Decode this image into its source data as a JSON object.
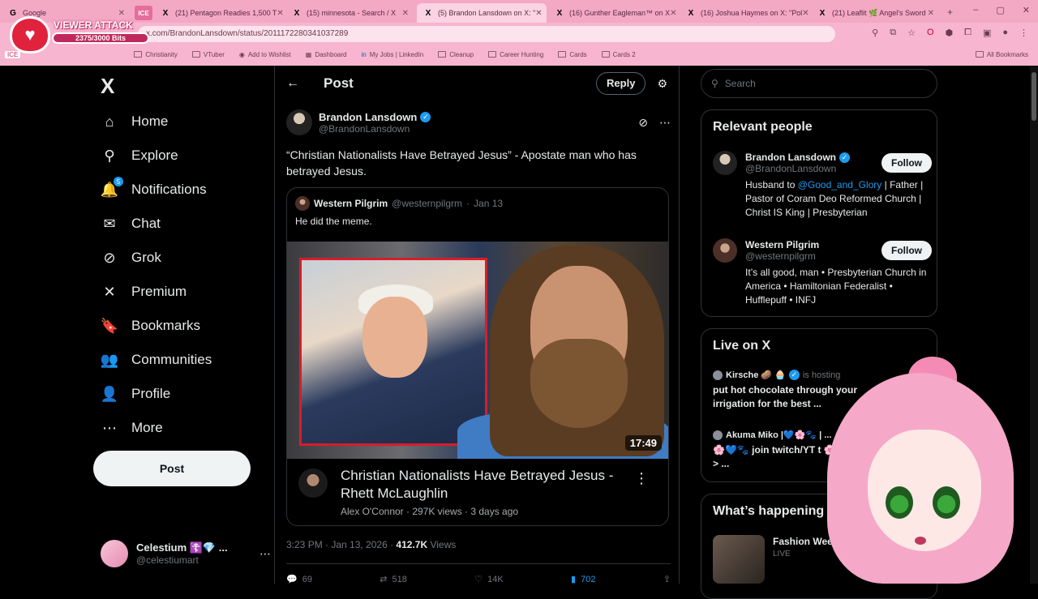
{
  "browser": {
    "tabs": [
      {
        "icon": "G",
        "label": "Google",
        "active": false
      },
      {
        "icon": "X",
        "label": "(21) Pentagon Readies 1,500 T",
        "active": false
      },
      {
        "icon": "X",
        "label": "(15) minnesota - Search / X",
        "active": false
      },
      {
        "icon": "X",
        "label": "(5) Brandon Lansdown on X: \"",
        "active": true
      },
      {
        "icon": "X",
        "label": "(16) Gunther Eagleman™ on X",
        "active": false
      },
      {
        "icon": "X",
        "label": "(16) Joshua Haymes on X: \"Pol",
        "active": false
      },
      {
        "icon": "X",
        "label": "(21) Leaflit 🌿 Angel's Sword",
        "active": false
      }
    ],
    "ice_tab": "ICE",
    "url": "x.com/BrandonLansdown/status/2011172280341037289",
    "bookmarks": [
      "Christianity",
      "VTuber",
      "Add to Wishlist",
      "Dashboard",
      "My Jobs | LinkedIn",
      "Cleanup",
      "Career Hunting",
      "Cards",
      "Cards 2"
    ],
    "bookmarks_all": "All Bookmarks",
    "ice_label": "ICE"
  },
  "overlay": {
    "title": "VIEWER ATTACK",
    "progress": "2375/3000 Bits",
    "progress_fraction": 0.79
  },
  "nav": {
    "logo": "X",
    "items": [
      {
        "label": "Home",
        "icon": "home-icon",
        "glyph": "⌂"
      },
      {
        "label": "Explore",
        "icon": "search-icon",
        "glyph": "⚲"
      },
      {
        "label": "Notifications",
        "icon": "bell-icon",
        "glyph": "🔔",
        "badge": "5"
      },
      {
        "label": "Chat",
        "icon": "mail-icon",
        "glyph": "✉"
      },
      {
        "label": "Grok",
        "icon": "grok-icon",
        "glyph": "⊘"
      },
      {
        "label": "Premium",
        "icon": "x-icon",
        "glyph": "✕"
      },
      {
        "label": "Bookmarks",
        "icon": "bookmark-icon",
        "glyph": "🔖"
      },
      {
        "label": "Communities",
        "icon": "people-icon",
        "glyph": "👥"
      },
      {
        "label": "Profile",
        "icon": "person-icon",
        "glyph": "👤"
      },
      {
        "label": "More",
        "icon": "more-icon",
        "glyph": "⋯"
      }
    ],
    "post_button": "Post",
    "account": {
      "name": "Celestium ☦️💎 ...",
      "handle": "@celestiumart"
    }
  },
  "post": {
    "header_title": "Post",
    "reply_button": "Reply",
    "author_name": "Brandon Lansdown",
    "author_handle": "@BrandonLansdown",
    "text": "“Christian Nationalists Have Betrayed Jesus” - Apostate man who has betrayed Jesus.",
    "quote": {
      "name": "Western Pilgrim",
      "handle": "@westernpilgrm",
      "date": "Jan 13",
      "text": "He did the meme.",
      "duration": "17:49",
      "video_title": "Christian Nationalists Have Betrayed Jesus - Rhett McLaughlin",
      "video_meta": "Alex O'Connor · 297K views · 3 days ago"
    },
    "timestamp": "3:23 PM · Jan 13, 2026 · ",
    "views": "412.7K",
    "views_label": " Views",
    "actions": {
      "replies": "69",
      "reposts": "518",
      "likes": "14K",
      "bookmarks": "702"
    }
  },
  "sidebar": {
    "search_placeholder": "Search",
    "relevant_title": "Relevant people",
    "people": [
      {
        "name": "Brandon Lansdown",
        "handle": "@BrandonLansdown",
        "follow": "Follow",
        "bio_pre": "Husband to ",
        "bio_link": "@Good_and_Glory",
        "bio_post": " | Father | Pastor of Coram Deo Reformed Church | Christ IS King | Presbyterian"
      },
      {
        "name": "Western Pilgrim",
        "handle": "@westernpilgrm",
        "follow": "Follow",
        "bio_pre": "It’s all good, man • Presbyterian Church in America • Hamiltonian Federalist • Hufflepuff • INFJ",
        "bio_link": "",
        "bio_post": ""
      }
    ],
    "live_title": "Live on X",
    "live": [
      {
        "host": "Kirsche 🥔 🧁",
        "status": "is hosting",
        "title": "put hot chocolate through your irrigation for the best ..."
      },
      {
        "host": "Akuma Miko |💙🌸🐾 | ...",
        "status": "",
        "title": "🌸💙🐾 join twitch/YT t 🌸💙🐾 ---> ..."
      }
    ],
    "happening_title": "What’s happening",
    "happening": {
      "title": "Fashion Week FW26 & Haute",
      "sub": "LIVE"
    }
  },
  "colors": {
    "accent": "#1d9bf0",
    "chrome": "#f7b5cf",
    "bg": "#000000"
  }
}
